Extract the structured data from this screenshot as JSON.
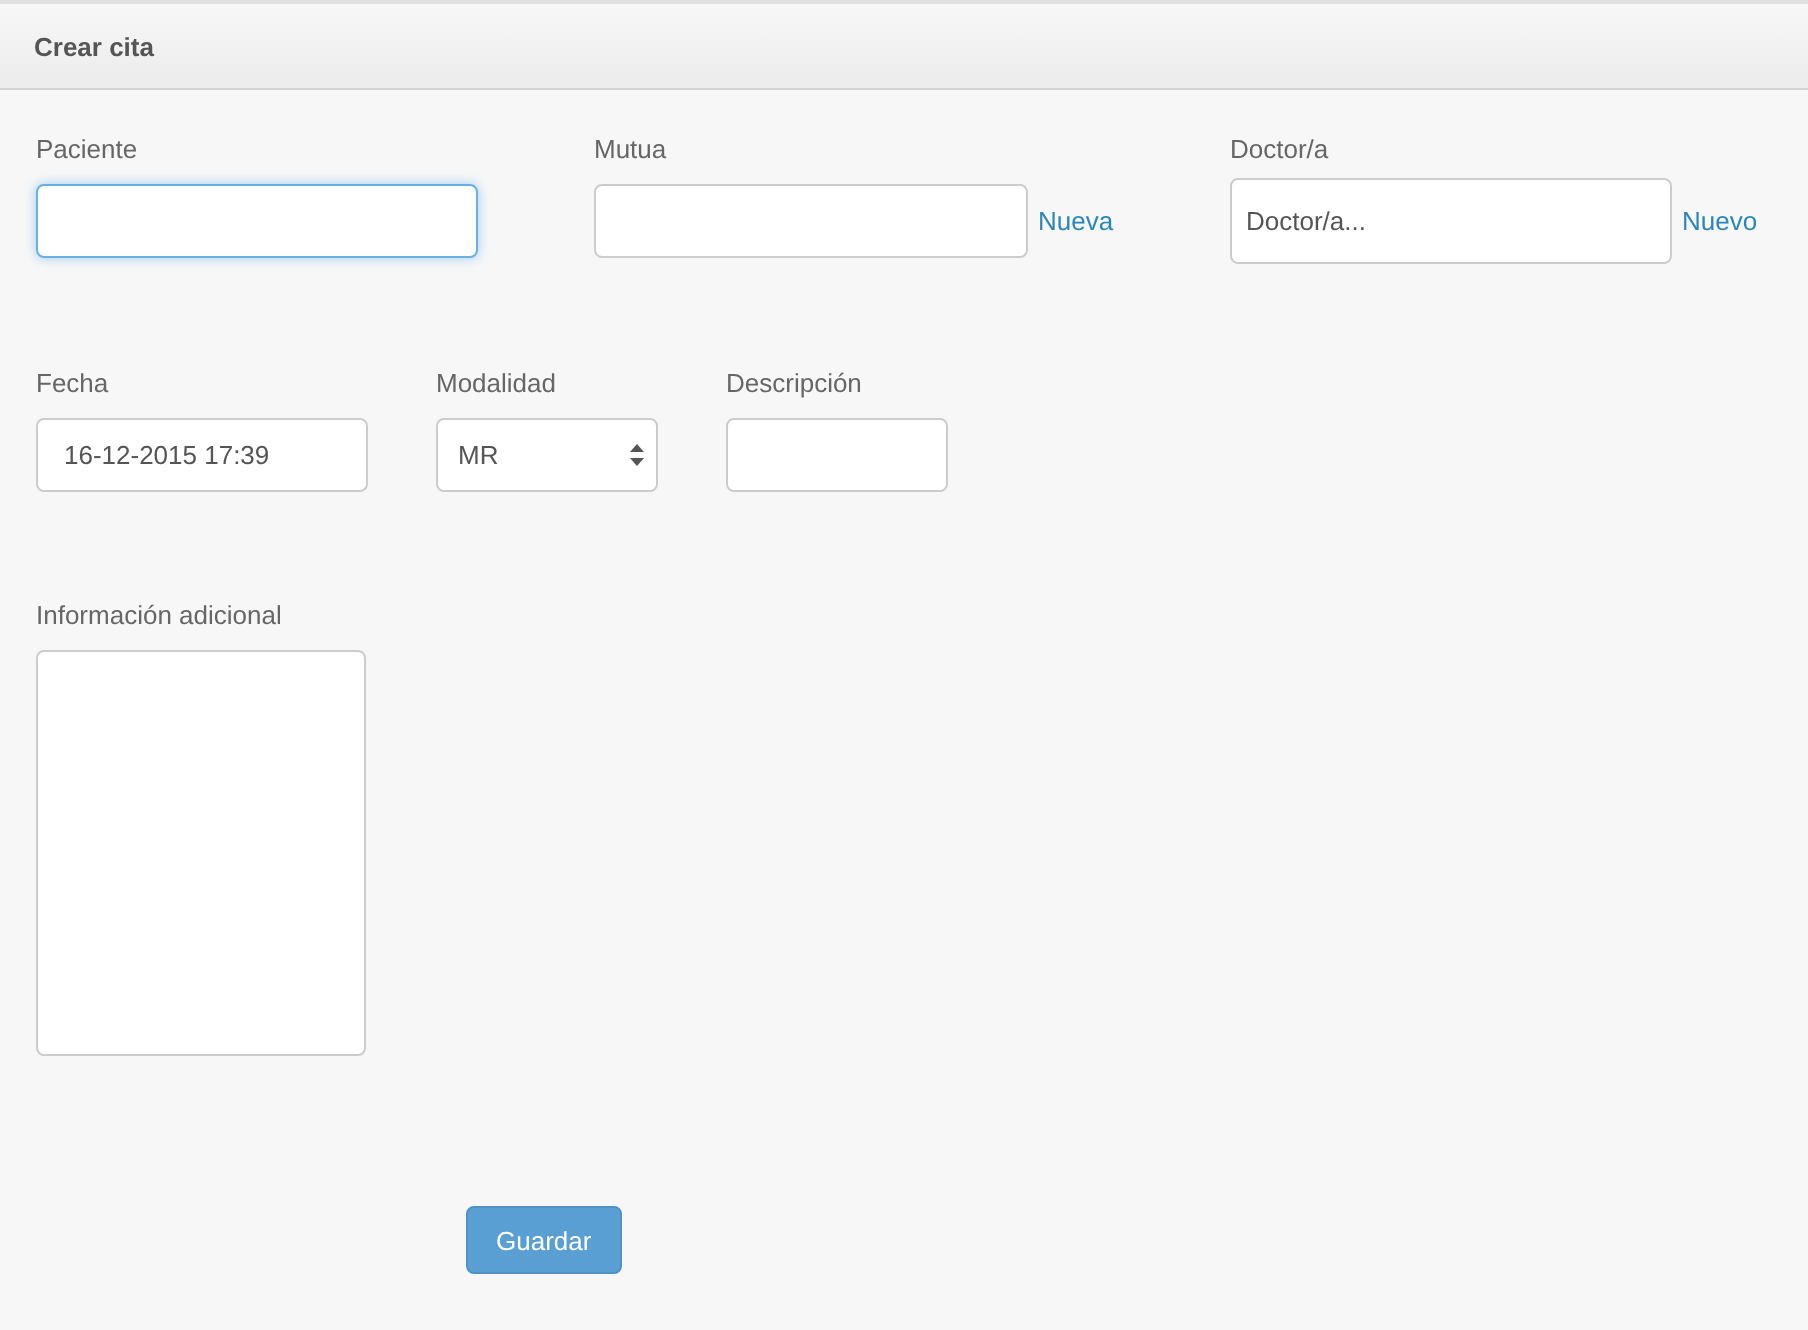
{
  "header": {
    "title": "Crear cita"
  },
  "rows": [
    [
      {
        "label": "Paciente",
        "kind": "text",
        "focused": true
      },
      {
        "label": "Mutua",
        "kind": "text",
        "focused": false,
        "link": "Nueva"
      },
      {
        "label": "Doctor/a",
        "kind": "text",
        "focused": false,
        "placeholder": "Doctor/a...",
        "link": "Nuevo"
      }
    ],
    [
      {
        "label": "Fecha",
        "kind": "text",
        "focused": false,
        "value": "16-12-2015 17:39"
      },
      {
        "label": "Modalidad",
        "kind": "select",
        "focused": false,
        "value": "MR"
      },
      {
        "label": "Descripción",
        "kind": "text",
        "focused": false
      }
    ],
    [
      {
        "label": "Información adicional",
        "kind": "textarea",
        "focused": false
      }
    ]
  ],
  "buttons": [
    {
      "label": "Guardar"
    }
  ]
}
